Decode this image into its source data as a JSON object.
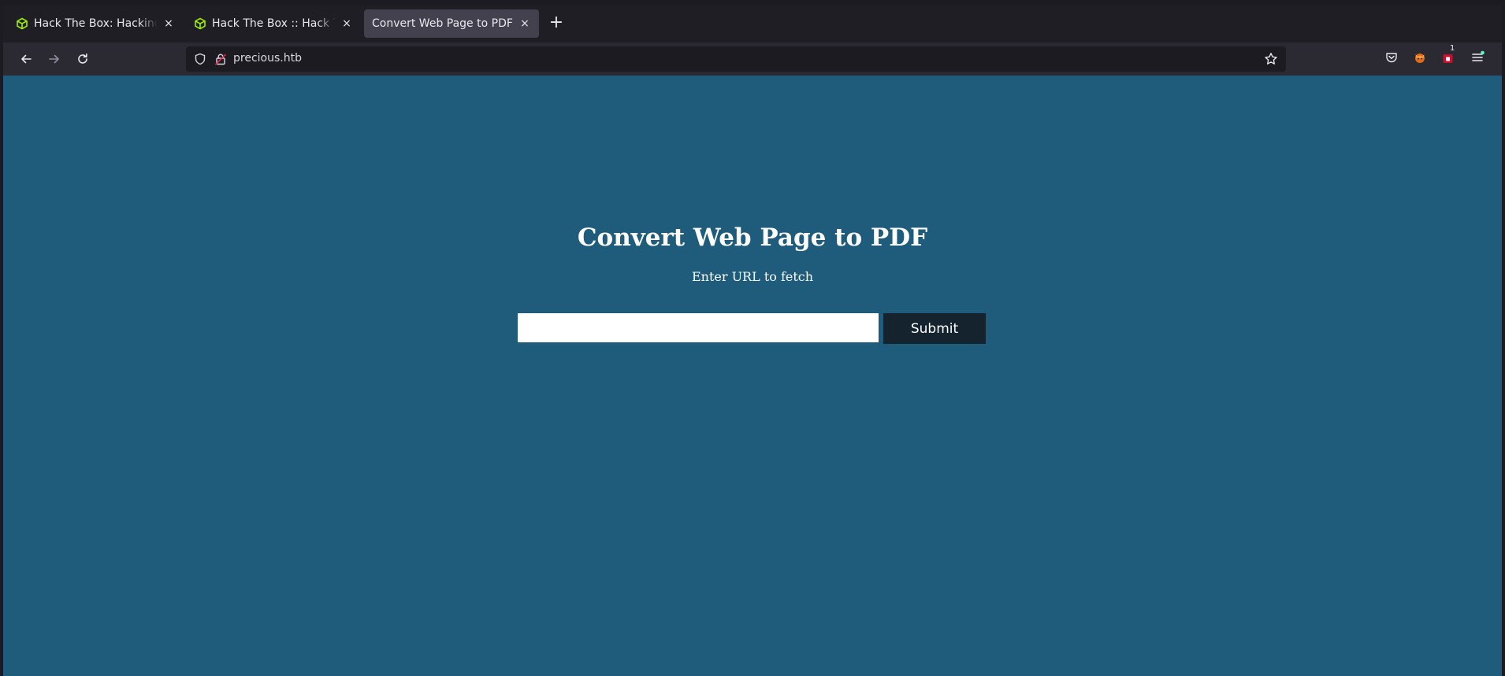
{
  "browser": {
    "tabs": [
      {
        "title": "Hack The Box: Hacking Training For The Best",
        "icon": "htb-cube-icon",
        "active": false
      },
      {
        "title": "Hack The Box :: Hack The Box",
        "icon": "htb-cube-icon",
        "active": false
      },
      {
        "title": "Convert Web Page to PDF",
        "icon": "",
        "active": true
      }
    ],
    "new_tab_label": "+",
    "close_glyph": "×",
    "url": "precious.htb",
    "badge_count": "1"
  },
  "page": {
    "heading": "Convert Web Page to PDF",
    "subheading": "Enter URL to fetch",
    "input_value": "",
    "submit_label": "Submit"
  },
  "colors": {
    "page_background": "#1f5b7a",
    "submit_background": "#14232e",
    "htb_green": "#9fef00"
  }
}
